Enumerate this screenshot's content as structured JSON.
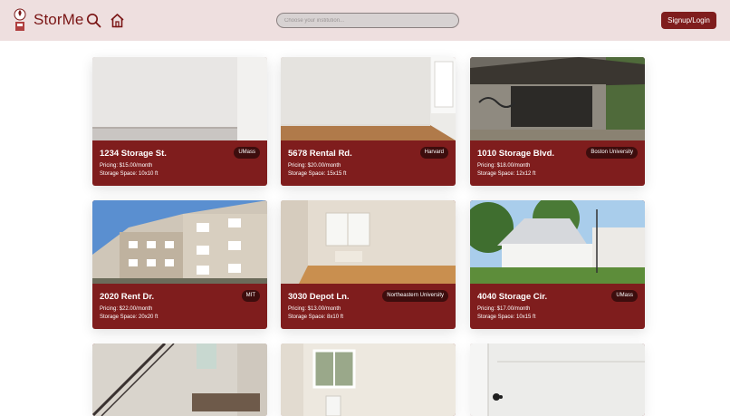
{
  "header": {
    "brand": "StorMe",
    "search_placeholder": "Choose your institution...",
    "signup_label": "Signup/Login",
    "icons": [
      "storme-logo-icon",
      "search-icon",
      "home-icon"
    ]
  },
  "colors": {
    "header_bg": "#eedfdf",
    "brand": "#7a1515",
    "card_bg": "#7f1d1d",
    "badge_bg": "#3d0d0d"
  },
  "listings": [
    {
      "title": "1234 Storage St.",
      "institution": "UMass",
      "pricing": "Pricing: $15.00/month",
      "space": "Storage Space: 10x10 ft",
      "photo": "empty-white-room"
    },
    {
      "title": "5678 Rental Rd.",
      "institution": "Harvard",
      "pricing": "Pricing: $20.00/month",
      "space": "Storage Space: 15x15 ft",
      "photo": "empty-room-hardwood-floor"
    },
    {
      "title": "1010 Storage Blvd.",
      "institution": "Boston University",
      "pricing": "Pricing: $18.00/month",
      "space": "Storage Space: 12x12 ft",
      "photo": "abandoned-garage-graffiti"
    },
    {
      "title": "2020 Rent Dr.",
      "institution": "MIT",
      "pricing": "Pricing: $22.00/month",
      "space": "Storage Space: 20x20 ft",
      "photo": "apartment-complex"
    },
    {
      "title": "3030 Depot Ln.",
      "institution": "Northeastern University",
      "pricing": "Pricing: $13.00/month",
      "space": "Storage Space: 8x10 ft",
      "photo": "empty-room-window"
    },
    {
      "title": "4040 Storage Cir.",
      "institution": "UMass",
      "pricing": "Pricing: $17.00/month",
      "space": "Storage Space: 10x15 ft",
      "photo": "white-house-trees"
    }
  ],
  "partial_listings": [
    {
      "photo": "loft-staircase"
    },
    {
      "photo": "small-room-radiator"
    },
    {
      "photo": "empty-closet"
    }
  ]
}
